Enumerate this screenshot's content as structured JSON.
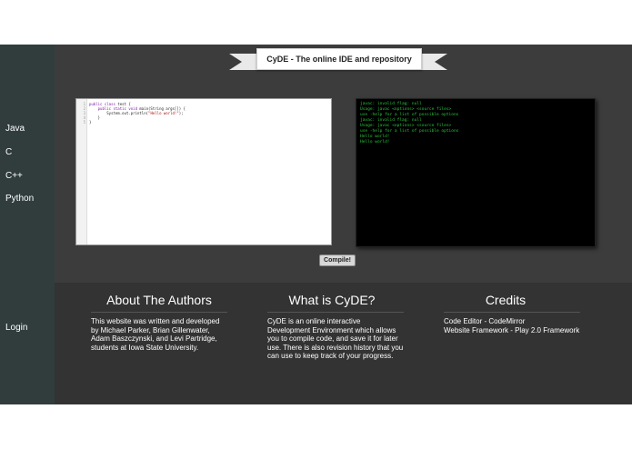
{
  "sidebar": {
    "items": [
      {
        "label": "Java"
      },
      {
        "label": "C"
      },
      {
        "label": "C++"
      },
      {
        "label": "Python"
      }
    ],
    "login_label": "Login"
  },
  "header": {
    "title": "CyDE - The online IDE and repository"
  },
  "editor": {
    "line_numbers": [
      "1",
      "2",
      "3",
      "4",
      "5"
    ],
    "code_lines": [
      {
        "kw": "public class",
        "rest": " test {",
        "str": "",
        "tail": ""
      },
      {
        "kw": "    public static void",
        "rest": " main(String args[]) {",
        "str": "",
        "tail": ""
      },
      {
        "kw": "",
        "rest": "        System.out.println(",
        "str": "\"Hello world!\"",
        "tail": ");"
      },
      {
        "kw": "",
        "rest": "    }",
        "str": "",
        "tail": ""
      },
      {
        "kw": "",
        "rest": "}",
        "str": "",
        "tail": ""
      }
    ]
  },
  "console": {
    "lines": [
      "javac: invalid flag: null",
      "Usage: javac <options> <source files>",
      "use -help for a list of possible options",
      "javac: invalid flag: null",
      "Usage: javac <options> <source files>",
      "use -help for a list of possible options",
      "Hello world!",
      "Hello world!"
    ]
  },
  "compile_label": "Compile!",
  "sections": [
    {
      "title": "About The Authors",
      "text": "This website was written and developed\nby Michael Parker, Brian Gillenwater,\nAdam Baszczynski, and Levi Partridge,\nstudents at Iowa State University."
    },
    {
      "title": "What is CyDE?",
      "text": "CyDE is an online interactive\nDevelopment Environment which allows\nyou to compile code, and save it for later\nuse. There is also revision history that you\ncan use to keep track of your progress."
    },
    {
      "title": "Credits",
      "text": "Code Editor - CodeMirror\nWebsite Framework - Play 2.0 Framework"
    }
  ]
}
